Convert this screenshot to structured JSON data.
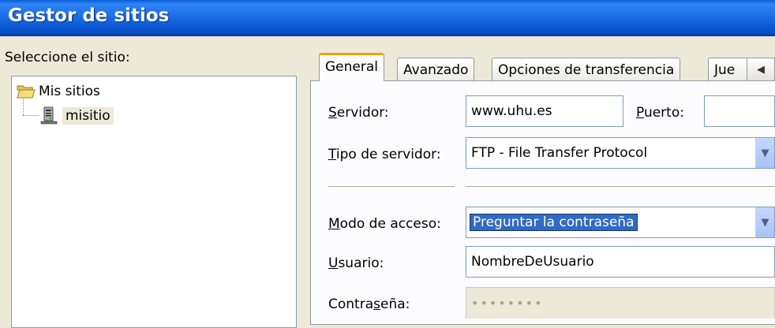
{
  "window": {
    "title": "Gestor de sitios"
  },
  "sites": {
    "label": "Seleccione el sitio:",
    "root": "Mis sitios",
    "child": "misitio"
  },
  "tabs": [
    {
      "label": "General"
    },
    {
      "label": "Avanzado"
    },
    {
      "label": "Opciones de transferencia"
    },
    {
      "label": "Jue"
    }
  ],
  "tab_scroll_glyph": "◀",
  "form": {
    "server": {
      "label_u": "S",
      "label_rest": "ervidor:",
      "value": "www.uhu.es"
    },
    "port": {
      "label_u": "P",
      "label_rest": "uerto:",
      "value": ""
    },
    "server_type": {
      "label_u": "T",
      "label_rest": "ipo de servidor:",
      "value": "FTP - File Transfer Protocol"
    },
    "access_mode": {
      "label_u": "M",
      "label_rest": "odo de acceso:",
      "value": "Preguntar la contraseña"
    },
    "user": {
      "label_u": "U",
      "label_rest": "suario:",
      "value": "NombreDeUsuario"
    },
    "password": {
      "label_pre": "Contra",
      "label_u": "s",
      "label_rest": "eña:",
      "value": "••••••••"
    }
  },
  "dropdown_glyph": "▼"
}
